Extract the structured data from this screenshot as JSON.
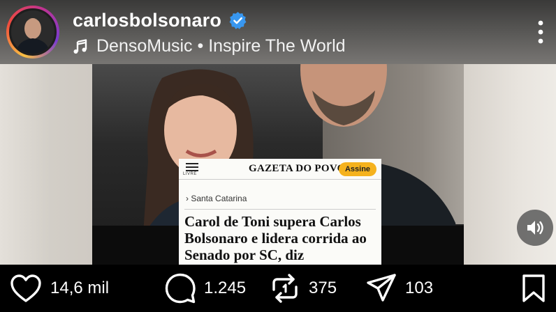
{
  "header": {
    "username": "carlosbolsonaro",
    "verified": true,
    "music": "DensoMusic • Inspire The World"
  },
  "post": {
    "article": {
      "brand": "GAZETA DO POVO",
      "brand_sub": "LIVRE",
      "action_button": "Assine",
      "section": "› Santa Catarina",
      "headline": "Carol de Toni supera Carlos Bolsonaro e lidera corrida ao Senado por SC, diz"
    }
  },
  "actions": {
    "likes": "14,6 mil",
    "comments": "1.245",
    "reposts": "375",
    "shares": "103"
  },
  "icons": [
    "avatar",
    "verified-badge-icon",
    "music-note-icon",
    "more-options-icon",
    "sound-icon",
    "heart-icon",
    "comment-icon",
    "repost-icon",
    "share-icon",
    "bookmark-icon"
  ],
  "colors": {
    "verified": "#3897f0",
    "accent_button": "#f5b21d",
    "background": "#000000"
  }
}
